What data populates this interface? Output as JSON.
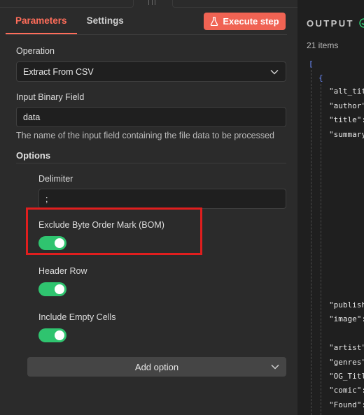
{
  "tabs": [
    {
      "label": "Parameters",
      "active": true
    },
    {
      "label": "Settings",
      "active": false
    }
  ],
  "execute_button": {
    "label": "Execute step",
    "icon": "flask-icon"
  },
  "operation": {
    "label": "Operation",
    "value": "Extract From CSV"
  },
  "input_binary_field": {
    "label": "Input Binary Field",
    "value": "data",
    "hint": "The name of the input field containing the file data to be processed"
  },
  "options": {
    "title": "Options",
    "delimiter": {
      "label": "Delimiter",
      "value": ";"
    },
    "exclude_bom": {
      "label": "Exclude Byte Order Mark (BOM)",
      "on": true
    },
    "header_row": {
      "label": "Header Row",
      "on": true
    },
    "include_empty_cells": {
      "label": "Include Empty Cells",
      "on": true
    },
    "add_option_label": "Add option"
  },
  "output": {
    "title": "OUTPUT",
    "items_count": "21 items",
    "json_open_bracket": "[",
    "json_open_brace": "{",
    "keys": [
      "\"alt_tit",
      "\"author\"",
      "\"title\":",
      "\"summary",
      "\"publish",
      "\"image\":",
      "\"artist\"",
      "\"genres\"",
      "\"OG_Titl",
      "\"comic\":",
      "\"Found\":"
    ]
  },
  "colors": {
    "accent": "#ff6d5a",
    "execute_bg": "#f06353",
    "toggle_on": "#2fc46f",
    "highlight_border": "#e01e1e",
    "json_bracket": "#6c8cff",
    "success_check": "#2fc46f"
  }
}
